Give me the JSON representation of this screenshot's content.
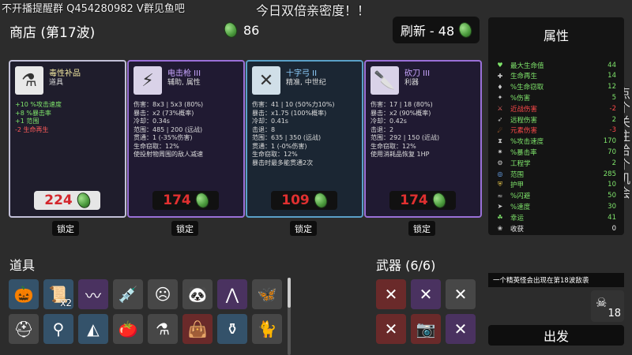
{
  "stream_overlay": {
    "top_left": "不开播提醒群  Q454280982 V群见鱼吧",
    "top_center": "今日双倍亲密度！！",
    "right_vertical": "点个关注，给个机会"
  },
  "header": {
    "shop_title": "商店 (第17波)",
    "materials": "86",
    "reroll_label": "刷新 - 48"
  },
  "cards": [
    {
      "name": "毒性补品",
      "subtitle": "道具",
      "icon": "mortar-icon",
      "stats": [
        "+10 %攻击速度",
        "+8 %暴击率",
        "+1 范围",
        "-2 生命再生"
      ],
      "price": "224",
      "lock_label": "锁定"
    },
    {
      "name": "电击枪 III",
      "subtitle": "辅助, 属性",
      "icon": "taser-icon",
      "stats": [
        "伤害：8x3 | 5x3 (80%)",
        "暴击：x2 (73%概率)",
        "冷却：0.34s",
        "范围：485 | 200 (远战)",
        "贯通：1 (-35%伤害)",
        "生命窃取：12%",
        "使投射物周围的敌人减速"
      ],
      "price": "174",
      "lock_label": "锁定"
    },
    {
      "name": "十字弓 II",
      "subtitle": "精准, 中世纪",
      "icon": "crossbow-icon",
      "stats": [
        "伤害：41 | 10 (50%力10%)",
        "暴击：x1.75 (100%概率)",
        "冷却：0.41s",
        "击退：8",
        "范围：635 | 350 (远战)",
        "贯通：1 (-0%伤害)",
        "生命窃取：12%",
        "暴击时最多能贯通2次"
      ],
      "price": "109",
      "lock_label": "锁定"
    },
    {
      "name": "砍刀 III",
      "subtitle": "利器",
      "icon": "cleaver-icon",
      "stats": [
        "伤害：17 | 18 (80%)",
        "暴击：x2 (90%概率)",
        "冷却：0.42s",
        "击退：2",
        "范围：292 | 150 (近战)",
        "生命窃取：12%",
        "使用消耗品恢复 1HP"
      ],
      "price": "174",
      "lock_label": "锁定"
    }
  ],
  "attributes": {
    "title": "属性",
    "rows": [
      {
        "label": "最大生命值",
        "value": "44",
        "tone": "pos",
        "icon": "heart-icon"
      },
      {
        "label": "生命再生",
        "value": "14",
        "tone": "pos",
        "icon": "regen-icon"
      },
      {
        "label": "%生命窃取",
        "value": "12",
        "tone": "pos",
        "icon": "lifesteal-icon"
      },
      {
        "label": "%伤害",
        "value": "5",
        "tone": "pos",
        "icon": "damage-icon"
      },
      {
        "label": "近战伤害",
        "value": "-2",
        "tone": "neg",
        "icon": "melee-icon"
      },
      {
        "label": "远程伤害",
        "value": "2",
        "tone": "pos",
        "icon": "ranged-icon"
      },
      {
        "label": "元素伤害",
        "value": "-3",
        "tone": "neg",
        "icon": "elemental-icon"
      },
      {
        "label": "%攻击速度",
        "value": "170",
        "tone": "pos",
        "icon": "attack-speed-icon"
      },
      {
        "label": "%暴击率",
        "value": "70",
        "tone": "pos",
        "icon": "crit-icon"
      },
      {
        "label": "工程学",
        "value": "2",
        "tone": "pos",
        "icon": "engineering-icon"
      },
      {
        "label": "范围",
        "value": "285",
        "tone": "pos",
        "icon": "range-icon"
      },
      {
        "label": "护甲",
        "value": "10",
        "tone": "pos",
        "icon": "armor-icon"
      },
      {
        "label": "%闪避",
        "value": "50",
        "tone": "pos",
        "icon": "dodge-icon"
      },
      {
        "label": "%速度",
        "value": "30",
        "tone": "pos",
        "icon": "speed-icon"
      },
      {
        "label": "幸运",
        "value": "41",
        "tone": "pos",
        "icon": "luck-icon"
      },
      {
        "label": "收获",
        "value": "0",
        "tone": "neutral",
        "icon": "harvest-icon"
      }
    ]
  },
  "items": {
    "title": "道具",
    "slots": [
      {
        "icon": "pumpkin-icon",
        "qty": "",
        "tier": "blue"
      },
      {
        "icon": "scroll-icon",
        "qty": "x2",
        "tier": "blue"
      },
      {
        "icon": "scarf-icon",
        "qty": "",
        "tier": "purple"
      },
      {
        "icon": "syringe-icon",
        "qty": "",
        "tier": "normal"
      },
      {
        "icon": "mask-icon",
        "qty": "",
        "tier": "normal"
      },
      {
        "icon": "panda-icon",
        "qty": "",
        "tier": "normal"
      },
      {
        "icon": "wings-icon",
        "qty": "",
        "tier": "purple"
      },
      {
        "icon": "butterfly-icon",
        "qty": "",
        "tier": "normal"
      },
      {
        "icon": "propeller-hat-icon",
        "qty": "",
        "tier": "normal"
      },
      {
        "icon": "lamp-icon",
        "qty": "",
        "tier": "blue"
      },
      {
        "icon": "fin-icon",
        "qty": "",
        "tier": "blue"
      },
      {
        "icon": "tomato-icon",
        "qty": "",
        "tier": "normal"
      },
      {
        "icon": "mortar-icon",
        "qty": "",
        "tier": "normal"
      },
      {
        "icon": "bag-icon",
        "qty": "",
        "tier": "red"
      },
      {
        "icon": "potion-icon",
        "qty": "",
        "tier": "blue"
      },
      {
        "icon": "cat-icon",
        "qty": "",
        "tier": "normal"
      }
    ]
  },
  "weapons": {
    "title": "武器 (6/6)",
    "slots": [
      {
        "icon": "crossbow-icon",
        "tier": "red"
      },
      {
        "icon": "crossbow-icon",
        "tier": "purple"
      },
      {
        "icon": "crossbow-icon",
        "tier": "normal"
      },
      {
        "icon": "crossbow-icon",
        "tier": "red"
      },
      {
        "icon": "camera-icon",
        "tier": "red"
      },
      {
        "icon": "crossbow-icon",
        "tier": "purple"
      }
    ]
  },
  "footer": {
    "elite_notice": "一个精英怪会出现在第18波敌袭",
    "wave_number": "18",
    "go_label": "出发"
  },
  "colors": {
    "positive": "#7fe56b",
    "negative": "#ff4a4a",
    "price_red": "#d3262c",
    "tier_purple": "#9a70d8",
    "tier_blue": "#5aa0c8"
  }
}
